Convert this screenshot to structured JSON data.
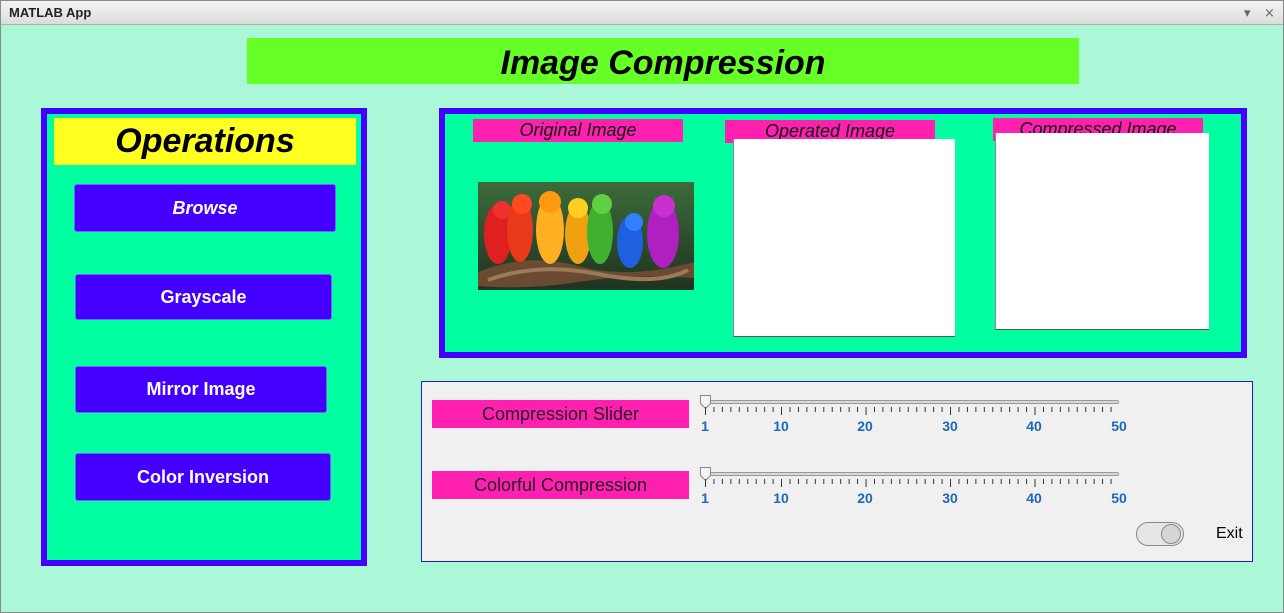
{
  "window": {
    "title": "MATLAB App",
    "controls": {
      "minimize": "▾",
      "close": "×"
    }
  },
  "header": {
    "title": "Image Compression"
  },
  "colors": {
    "background": "#aaf8d8",
    "panel": "#00ffa0",
    "panel_border": "#4400ff",
    "title_bg": "#66ff26",
    "ops_title_bg": "#ffff20",
    "label_bg": "#ff20b0",
    "button_bg": "#4400ff",
    "tick_label": "#1a68b8"
  },
  "operations": {
    "title": "Operations",
    "buttons": [
      {
        "label": "Browse"
      },
      {
        "label": "Grayscale"
      },
      {
        "label": "Mirror Image"
      },
      {
        "label": "Color Inversion"
      }
    ]
  },
  "images": {
    "original": {
      "label": "Original Image",
      "content": "colorful parrots on branch"
    },
    "operated": {
      "label": "Operated Image"
    },
    "compressed": {
      "label": "Compressed Image"
    }
  },
  "sliders": [
    {
      "label": "Compression Slider",
      "min": 1,
      "max": 50,
      "value": 1,
      "tick_labels": [
        "1",
        "10",
        "20",
        "30",
        "40",
        "50"
      ]
    },
    {
      "label": "Colorful Compression",
      "min": 1,
      "max": 50,
      "value": 1,
      "tick_labels": [
        "1",
        "10",
        "20",
        "30",
        "40",
        "50"
      ]
    }
  ],
  "exit": {
    "label": "Exit",
    "state": "off"
  }
}
